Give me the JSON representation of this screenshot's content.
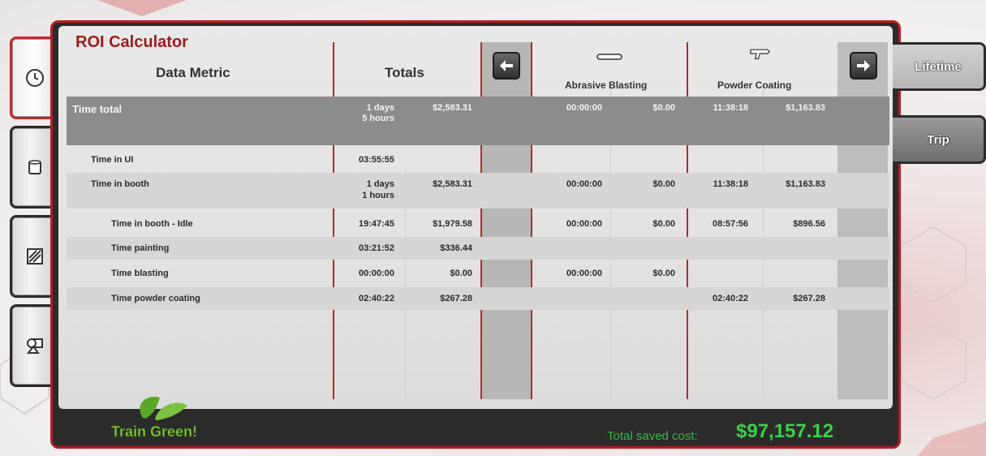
{
  "title": "ROI Calculator",
  "headers": {
    "metric": "Data Metric",
    "totals": "Totals",
    "col1": "Abrasive Blasting",
    "col2": "Powder Coating"
  },
  "nav": {
    "prev_icon": "arrow-left-icon",
    "next_icon": "arrow-right-icon"
  },
  "left_tabs": [
    {
      "icon": "clock-icon",
      "active": true
    },
    {
      "icon": "paint-can-icon",
      "active": false
    },
    {
      "icon": "texture-icon",
      "active": false
    },
    {
      "icon": "shapes-icon",
      "active": false
    }
  ],
  "right_tabs": {
    "lifetime": "Lifetime",
    "trip": "Trip"
  },
  "rows": [
    {
      "label": "Time total",
      "t_time": "1 days",
      "t_time2": "5 hours",
      "t_cost": "$2,583.31",
      "a_time": "00:00:00",
      "a_cost": "$0.00",
      "p_time": "11:38:18",
      "p_cost": "$1,163.83"
    },
    {
      "label": "Time in UI",
      "t_time": "03:55:55",
      "t_time2": "",
      "t_cost": "",
      "a_time": "",
      "a_cost": "",
      "p_time": "",
      "p_cost": ""
    },
    {
      "label": "Time in booth",
      "t_time": "1 days",
      "t_time2": "1 hours",
      "t_cost": "$2,583.31",
      "a_time": "00:00:00",
      "a_cost": "$0.00",
      "p_time": "11:38:18",
      "p_cost": "$1,163.83"
    },
    {
      "label": "Time in booth - Idle",
      "t_time": "19:47:45",
      "t_time2": "",
      "t_cost": "$1,979.58",
      "a_time": "00:00:00",
      "a_cost": "$0.00",
      "p_time": "08:57:56",
      "p_cost": "$896.56"
    },
    {
      "label": "Time painting",
      "t_time": "03:21:52",
      "t_time2": "",
      "t_cost": "$336.44",
      "a_time": "",
      "a_cost": "",
      "p_time": "",
      "p_cost": ""
    },
    {
      "label": "Time blasting",
      "t_time": "00:00:00",
      "t_time2": "",
      "t_cost": "$0.00",
      "a_time": "00:00:00",
      "a_cost": "$0.00",
      "p_time": "",
      "p_cost": ""
    },
    {
      "label": "Time powder coating",
      "t_time": "02:40:22",
      "t_time2": "",
      "t_cost": "$267.28",
      "a_time": "",
      "a_cost": "",
      "p_time": "02:40:22",
      "p_cost": "$267.28"
    }
  ],
  "footer": {
    "label": "Total saved cost:",
    "value": "$97,157.12",
    "logo_text": "Train Green!"
  },
  "colors": {
    "accent": "#b42a2a",
    "green": "#39d24a",
    "title": "#9b1c1c"
  }
}
